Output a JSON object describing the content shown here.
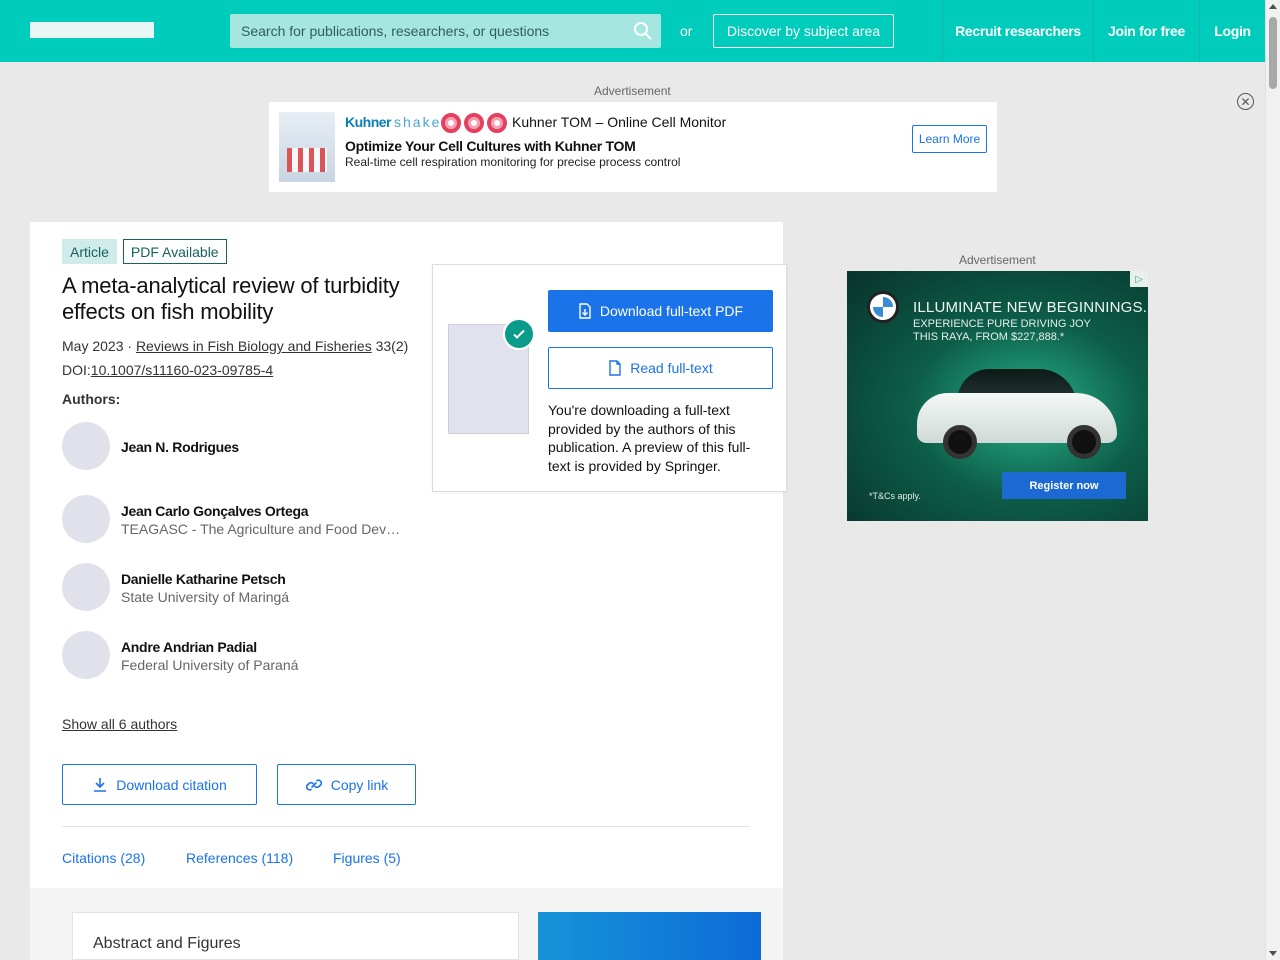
{
  "header": {
    "search_placeholder": "Search for publications, researchers, or questions",
    "or_label": "or",
    "discover_label": "Discover by subject area",
    "nav": [
      "Recruit researchers",
      "Join for free",
      "Login"
    ],
    "brand_color": "#00ccbb"
  },
  "ads": {
    "label": "Advertisement",
    "top": {
      "brand": "Kuhner",
      "brand_suffix": "shaker",
      "product": "Kuhner TOM – Online Cell Monitor",
      "headline": "Optimize Your Cell Cultures with Kuhner TOM",
      "sub": "Real-time cell respiration monitoring for precise process control",
      "cta": "Learn More"
    },
    "side": {
      "line1": "ILLUMINATE NEW BEGINNINGS.",
      "line2": "EXPERIENCE PURE DRIVING JOY",
      "line3": "THIS RAYA, FROM $227,888.*",
      "terms": "*T&Cs apply.",
      "cta": "Register now"
    }
  },
  "publication": {
    "type_badge": "Article",
    "pdf_badge": "PDF Available",
    "title": "A meta-analytical review of turbidity effects on fish mobility",
    "date": "May 2023 · ",
    "journal": "Reviews in Fish Biology and Fisheries",
    "volume": " 33(2)",
    "doi_label": "DOI:",
    "doi": "10.1007/s11160-023-09785-4",
    "authors_label": "Authors:",
    "authors": [
      {
        "name": "Jean N. Rodrigues",
        "affiliation": ""
      },
      {
        "name": "Jean Carlo Gonçalves Ortega",
        "affiliation": "TEAGASC - The Agriculture and Food Dev…"
      },
      {
        "name": "Danielle Katharine Petsch",
        "affiliation": "State University of Maringá"
      },
      {
        "name": "Andre Andrian Padial",
        "affiliation": "Federal University of Paraná"
      }
    ],
    "show_all": "Show all 6 authors",
    "download_citation": "Download citation",
    "copy_link": "Copy link",
    "tabs": [
      "Citations (28)",
      "References (118)",
      "Figures (5)"
    ],
    "abstract_heading": "Abstract and Figures"
  },
  "download_popover": {
    "primary": "Download full-text PDF",
    "secondary": "Read full-text",
    "note": "You're downloading a full-text provided by the authors of this publication. A preview of this full-text is provided by Springer."
  }
}
